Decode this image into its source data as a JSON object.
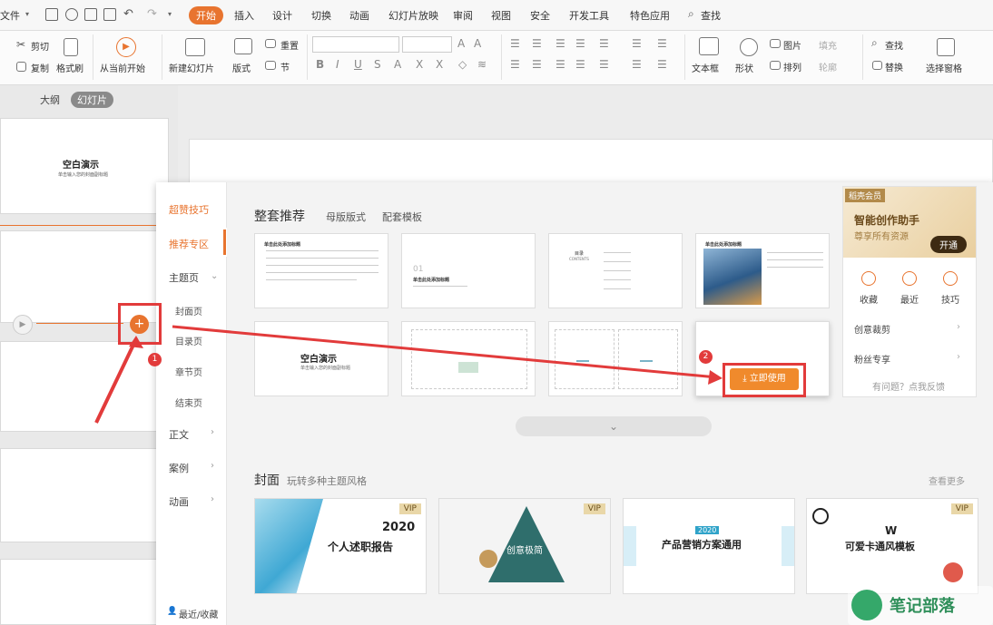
{
  "menubar": {
    "file": "文件",
    "tabs": [
      "开始",
      "插入",
      "设计",
      "切换",
      "动画",
      "幻灯片放映",
      "审阅",
      "视图",
      "安全",
      "开发工具",
      "特色应用"
    ],
    "search": "查找"
  },
  "ribbon": {
    "cut": "剪切",
    "copy": "复制",
    "format_painter": "格式刷",
    "from_current": "从当前开始",
    "new_slide": "新建幻灯片",
    "layout": "版式",
    "reset": "重置",
    "section": "节",
    "textbox": "文本框",
    "shape": "形状",
    "picture": "图片",
    "fill": "填充",
    "arrange": "排列",
    "outline": "轮廓",
    "find": "查找",
    "replace": "替换",
    "select_pane": "选择窗格"
  },
  "left_panel": {
    "tab_outline": "大纲",
    "tab_slides": "幻灯片",
    "slide1_title": "空白演示",
    "slide1_sub": "单击输入您的封面副标题"
  },
  "popup": {
    "nav": {
      "tips": "超赞技巧",
      "recommended": "推荐专区",
      "theme_page": "主题页",
      "cover": "封面页",
      "toc": "目录页",
      "chapter": "章节页",
      "end": "结束页",
      "body": "正文",
      "case": "案例",
      "animation": "动画",
      "recent": "最近/收藏"
    },
    "section_title": "整套推荐",
    "tab_master": "母版版式",
    "tab_template": "配套模板",
    "cards": {
      "card1_title": "单击此处添加标题",
      "card2_num": "01",
      "card2_title": "单击此处添加标题",
      "card3_label": "目录",
      "card3_sub": "CONTENTS",
      "card5_title": "空白演示",
      "card5_sub": "单击输入您的封面副标题"
    },
    "use_now": "立即使用",
    "cover_title": "封面",
    "cover_sub": "玩转多种主题风格",
    "see_more": "查看更多",
    "covers": [
      {
        "vip": "VIP",
        "line1": "2020",
        "line2": "个人述职报告"
      },
      {
        "vip": "VIP",
        "line1": "创意极简",
        "line2": ""
      },
      {
        "vip": "",
        "line1": "2020",
        "line2": "产品营销方案通用"
      },
      {
        "vip": "VIP",
        "line1": "W",
        "line2": "可爱卡通风模板"
      }
    ],
    "member": {
      "badge": "稻壳会员",
      "title": "智能创作助手",
      "sub": "尊享所有资源",
      "open": "开通",
      "fav": "收藏",
      "recent": "最近",
      "tips": "技巧",
      "creative_cut": "创意裁剪",
      "fan_zone": "粉丝专享",
      "feedback": "有问题？点我反馈"
    }
  },
  "annotations": {
    "n1": "1",
    "n2": "2"
  },
  "watermark": "笔记部落"
}
